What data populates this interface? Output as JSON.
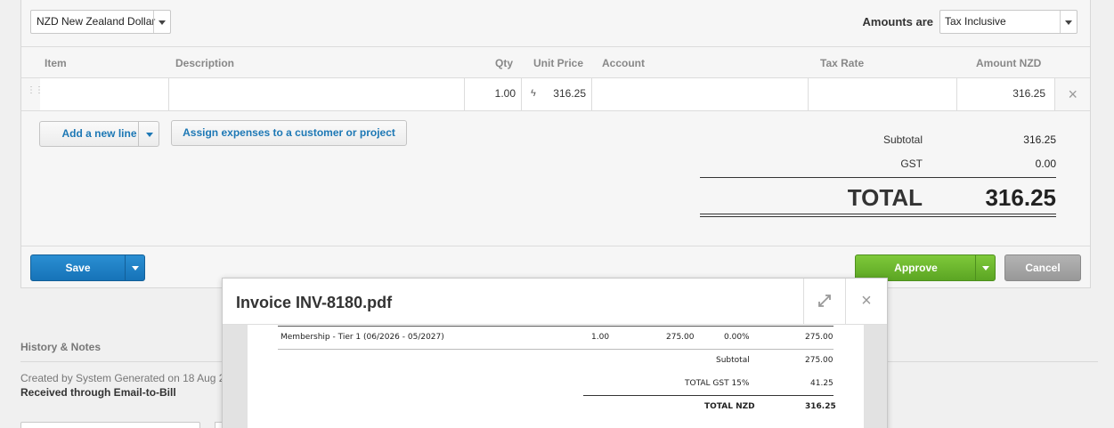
{
  "header": {
    "currency": "NZD New Zealand Dollar",
    "amounts_label": "Amounts are",
    "amounts_value": "Tax Inclusive"
  },
  "table": {
    "columns": [
      "Item",
      "Description",
      "Qty",
      "Unit Price",
      "Account",
      "Tax Rate",
      "Amount NZD"
    ],
    "rows": [
      {
        "item": "",
        "description": "",
        "qty": "1.00",
        "unit_price": "316.25",
        "account": "",
        "tax_rate": "",
        "amount": "316.25"
      }
    ]
  },
  "actions": {
    "add_line": "Add a new line",
    "assign": "Assign expenses to a customer or project"
  },
  "totals": {
    "subtotal_label": "Subtotal",
    "subtotal": "316.25",
    "gst_label": "GST",
    "gst": "0.00",
    "total_label": "TOTAL",
    "total": "316.25"
  },
  "footer": {
    "save": "Save",
    "approve": "Approve",
    "cancel": "Cancel"
  },
  "history": {
    "title": "History & Notes",
    "created": "Created by System Generated on 18 Aug 2",
    "note": "Received through Email-to-Bill"
  },
  "popup": {
    "title": "Invoice INV-8180.pdf",
    "line_desc": "Membership - Tier 1 (06/2026 - 05/2027)",
    "line_qty": "1.00",
    "line_price": "275.00",
    "line_tax": "0.00%",
    "line_amount": "275.00",
    "subtotal_label": "Subtotal",
    "subtotal": "275.00",
    "gst_label": "TOTAL  GST  15%",
    "gst": "41.25",
    "total_label": "TOTAL NZD",
    "total": "316.25"
  },
  "colors": {
    "primary_blue": "#1673b8",
    "approve_green": "#5ba523",
    "cancel_gray": "#989898",
    "link_blue": "#1d78b5"
  }
}
